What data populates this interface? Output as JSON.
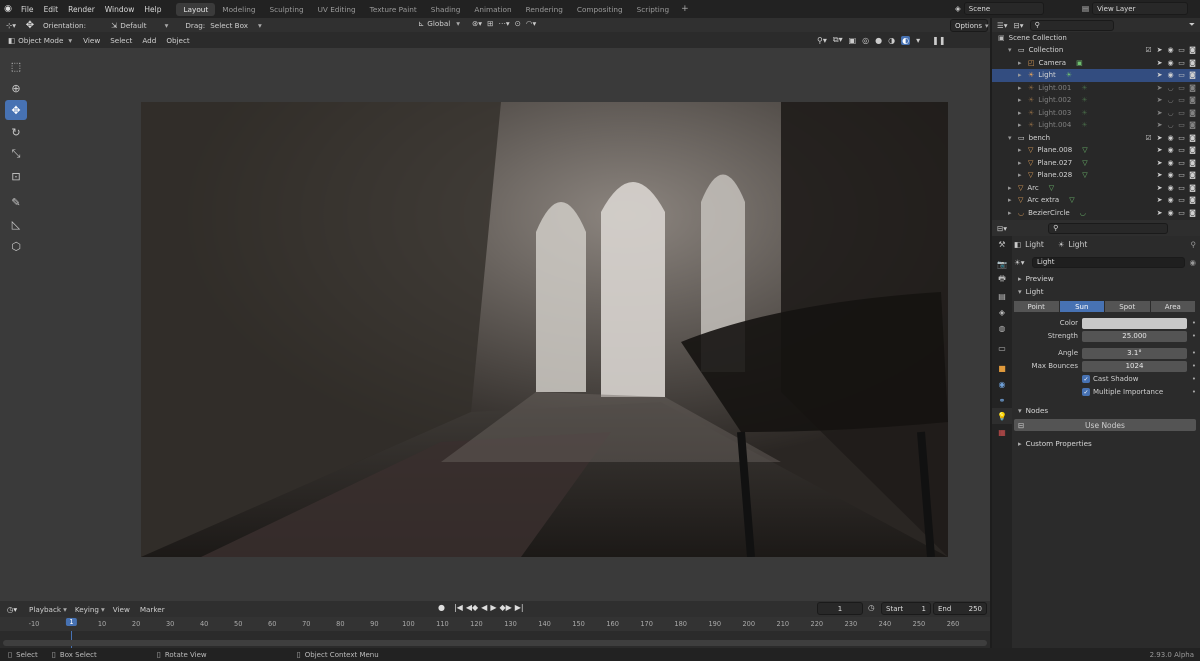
{
  "topbar": {
    "menus": [
      "File",
      "Edit",
      "Render",
      "Window",
      "Help"
    ],
    "workspaces": [
      "Layout",
      "Modeling",
      "Sculpting",
      "UV Editing",
      "Texture Paint",
      "Shading",
      "Animation",
      "Rendering",
      "Compositing",
      "Scripting"
    ],
    "active_workspace": "Layout",
    "add_workspace": "+",
    "scene": "Scene",
    "view_layer": "View Layer"
  },
  "tool_header": {
    "orientation_label": "Orientation:",
    "orientation_value": "Default",
    "drag_label": "Drag:",
    "drag_value": "Select Box",
    "transform_orientation": "Global",
    "options": "Options"
  },
  "view_header": {
    "mode": "Object Mode",
    "menus": [
      "View",
      "Select",
      "Add",
      "Object"
    ]
  },
  "outliner": {
    "root": "Scene Collection",
    "rows": [
      {
        "label": "Collection",
        "indent": 1,
        "icon": "collection",
        "state": "normal"
      },
      {
        "label": "Camera",
        "indent": 2,
        "icon": "camera",
        "state": "normal"
      },
      {
        "label": "Light",
        "indent": 2,
        "icon": "light",
        "state": "selected"
      },
      {
        "label": "Light.001",
        "indent": 2,
        "icon": "light",
        "state": "dim"
      },
      {
        "label": "Light.002",
        "indent": 2,
        "icon": "light",
        "state": "dim"
      },
      {
        "label": "Light.003",
        "indent": 2,
        "icon": "light",
        "state": "dim"
      },
      {
        "label": "Light.004",
        "indent": 2,
        "icon": "light",
        "state": "dim"
      },
      {
        "label": "bench",
        "indent": 1,
        "icon": "collection",
        "state": "normal"
      },
      {
        "label": "Plane.008",
        "indent": 2,
        "icon": "mesh",
        "state": "normal"
      },
      {
        "label": "Plane.027",
        "indent": 2,
        "icon": "mesh",
        "state": "normal"
      },
      {
        "label": "Plane.028",
        "indent": 2,
        "icon": "mesh",
        "state": "normal"
      },
      {
        "label": "Arc",
        "indent": 1,
        "icon": "mesh",
        "state": "normal"
      },
      {
        "label": "Arc extra",
        "indent": 1,
        "icon": "mesh",
        "state": "normal"
      },
      {
        "label": "BezierCircle",
        "indent": 1,
        "icon": "curve",
        "state": "normal"
      }
    ]
  },
  "properties": {
    "breadcrumb_object": "Light",
    "breadcrumb_data": "Light",
    "datablock_name": "Light",
    "panel_preview": "Preview",
    "panel_light": "Light",
    "light_types": [
      "Point",
      "Sun",
      "Spot",
      "Area"
    ],
    "active_light_type": "Sun",
    "color_label": "Color",
    "color_value": "#c8c8c8",
    "strength_label": "Strength",
    "strength_value": "25.000",
    "angle_label": "Angle",
    "angle_value": "3.1°",
    "max_bounces_label": "Max Bounces",
    "max_bounces_value": "1024",
    "cast_shadow": "Cast Shadow",
    "multiple_importance": "Multiple Importance",
    "panel_nodes": "Nodes",
    "use_nodes": "Use Nodes",
    "panel_custom": "Custom Properties"
  },
  "timeline": {
    "menus": [
      "Playback",
      "Keying",
      "View",
      "Marker"
    ],
    "current_frame": "1",
    "start_label": "Start",
    "start_value": "1",
    "end_label": "End",
    "end_value": "250",
    "ruler_ticks": [
      "-10",
      "1",
      "10",
      "20",
      "30",
      "40",
      "50",
      "60",
      "70",
      "80",
      "90",
      "100",
      "110",
      "120",
      "130",
      "140",
      "150",
      "160",
      "170",
      "180",
      "190",
      "200",
      "210",
      "220",
      "230",
      "240",
      "250",
      "260"
    ]
  },
  "statusbar": {
    "select": "Select",
    "box_select": "Box Select",
    "rotate_view": "Rotate View",
    "context_menu": "Object Context Menu",
    "version": "2.93.0 Alpha"
  }
}
